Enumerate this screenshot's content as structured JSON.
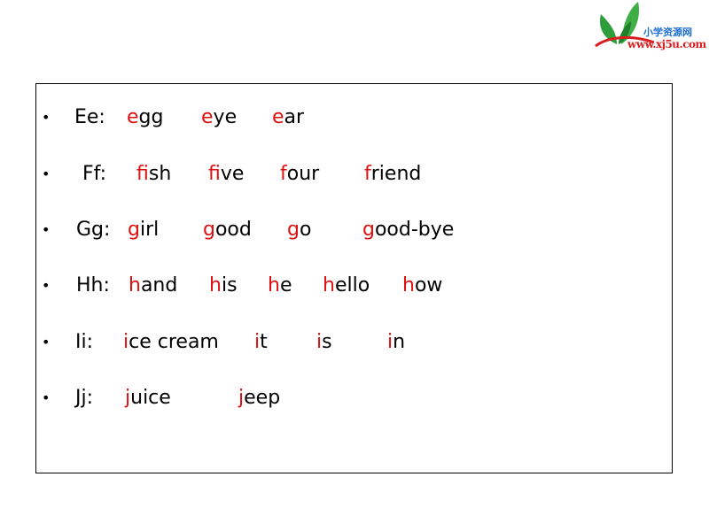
{
  "logo": {
    "site_name_cn": "小学资源网",
    "url": "www.xj5u.com"
  },
  "colors": {
    "highlight": "#e01010",
    "text": "#000000",
    "logo_green": "#2e9e3a",
    "logo_blue": "#1f6fd1",
    "logo_red": "#d81e1e"
  },
  "rows": [
    {
      "label": "Ee:",
      "words": [
        {
          "first": "e",
          "rest": "gg"
        },
        {
          "first": "e",
          "rest": "ye"
        },
        {
          "first": "e",
          "rest": "ar"
        }
      ]
    },
    {
      "label": "Ff:",
      "words": [
        {
          "first": "f",
          "rest": "ish"
        },
        {
          "first": "f",
          "rest": "ive"
        },
        {
          "first": "f",
          "rest": "our"
        },
        {
          "first": "f",
          "rest": "riend"
        }
      ]
    },
    {
      "label": "Gg:",
      "words": [
        {
          "first": "g",
          "rest": "irl"
        },
        {
          "first": "g",
          "rest": "ood"
        },
        {
          "first": "g",
          "rest": "o"
        },
        {
          "first": "g",
          "rest": "ood-bye"
        }
      ]
    },
    {
      "label": "Hh:",
      "words": [
        {
          "first": "h",
          "rest": "and"
        },
        {
          "first": "h",
          "rest": "is"
        },
        {
          "first": "h",
          "rest": "e"
        },
        {
          "first": "h",
          "rest": "ello"
        },
        {
          "first": "h",
          "rest": "ow"
        }
      ]
    },
    {
      "label": "Ii:",
      "words": [
        {
          "first": "i",
          "rest": "ce cream"
        },
        {
          "first": "i",
          "rest": "t"
        },
        {
          "first": "i",
          "rest": "s"
        },
        {
          "first": "i",
          "rest": "n"
        }
      ]
    },
    {
      "label": "Jj:",
      "words": [
        {
          "first": "j",
          "rest": "uice"
        },
        {
          "first": "j",
          "rest": "eep"
        }
      ]
    }
  ],
  "bullet": "•"
}
